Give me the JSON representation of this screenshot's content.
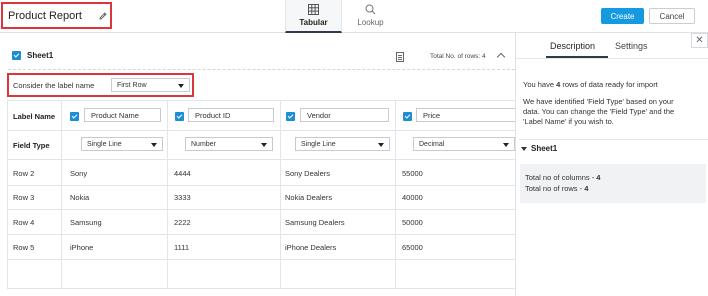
{
  "header": {
    "title": "Product Report",
    "tabs": [
      {
        "label": "Tabular",
        "icon": "table-icon",
        "active": true
      },
      {
        "label": "Lookup",
        "icon": "search-icon",
        "active": false
      }
    ],
    "create_label": "Create",
    "cancel_label": "Cancel",
    "accent_color": "#159ae0",
    "highlight_color": "#d9363e"
  },
  "sheet": {
    "name": "Sheet1",
    "total_rows_text": "Total No. of rows:  4",
    "label_name_prompt": "Consider the label name",
    "label_name_value": "First Row"
  },
  "table": {
    "row_label_header": "Label Name",
    "field_type_header": "Field Type",
    "columns": [
      {
        "label": "Product Name",
        "field_type": "Single Line"
      },
      {
        "label": "Product ID",
        "field_type": "Number"
      },
      {
        "label": "Vendor",
        "field_type": "Single Line"
      },
      {
        "label": "Price",
        "field_type": "Decimal"
      }
    ],
    "rows": [
      {
        "label": "Row 2",
        "cells": [
          "Sony",
          "4444",
          "Sony Dealers",
          "55000"
        ]
      },
      {
        "label": "Row 3",
        "cells": [
          "Nokia",
          "3333",
          "Nokia Dealers",
          "40000"
        ]
      },
      {
        "label": "Row 4",
        "cells": [
          "Samsung",
          "2222",
          "Samsung Dealers",
          "50000"
        ]
      },
      {
        "label": "Row 5",
        "cells": [
          "iPhone",
          "1111",
          "iPhone Dealers",
          "65000"
        ]
      }
    ]
  },
  "side_panel": {
    "tabs": [
      "Description",
      "Settings"
    ],
    "close_icon": "close-icon",
    "line1_prefix": "You have ",
    "line1_count": "4",
    "line1_suffix": " rows of data ready for import",
    "para_line1": "We have identified 'Field Type' based on your",
    "para_line2": "data. You can change the 'Field Type' and the",
    "para_line3": "'Label Name' if you wish to.",
    "sheet_name": "Sheet1",
    "columns_prefix": "Total no of columns - ",
    "columns_count": "4",
    "rows_prefix": "Total no of rows - ",
    "rows_count": "4"
  }
}
